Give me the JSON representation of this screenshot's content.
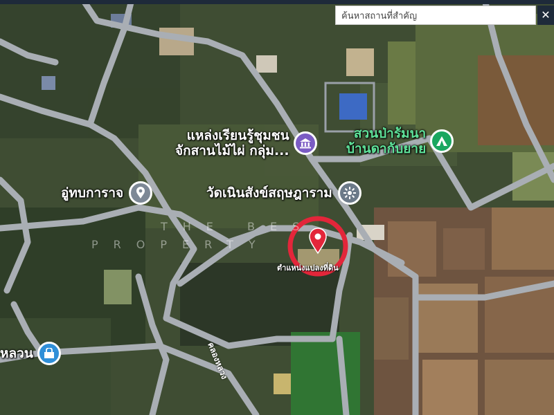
{
  "search": {
    "placeholder": "ค้นหาสถานที่สำคัญ",
    "close_label": "✕"
  },
  "pois": [
    {
      "id": "learning-center",
      "line1": "แหล่งเรียนรู้ชุมชน",
      "line2": "จักสานไม้ไผ่ กลุ่ม...",
      "icon": "museum-icon",
      "color": "#7b5cc4"
    },
    {
      "id": "forest-park",
      "line1": "สวนป่ารัมนา",
      "line2": "บ้านดากับยาย",
      "icon": "tent-icon",
      "color": "#1aa760"
    },
    {
      "id": "garage",
      "line1": "อู่ทบการาจ",
      "line2": "",
      "icon": "pin-icon",
      "color": "#7d8896"
    },
    {
      "id": "temple",
      "line1": "วัดเนินสังข์สฤษฎาราม",
      "line2": "",
      "icon": "temple-icon",
      "color": "#6c7a89"
    },
    {
      "id": "village",
      "line1": "หลวน",
      "line2": "",
      "icon": "shop-icon",
      "color": "#2f8fd8"
    }
  ],
  "watermark": {
    "line1": "THE BES",
    "line2": "PROPERTY"
  },
  "marker": {
    "label": "ตำแหน่งแปลงที่ดิน",
    "color": "#e3263a"
  },
  "road_label": "คลองหลวง"
}
